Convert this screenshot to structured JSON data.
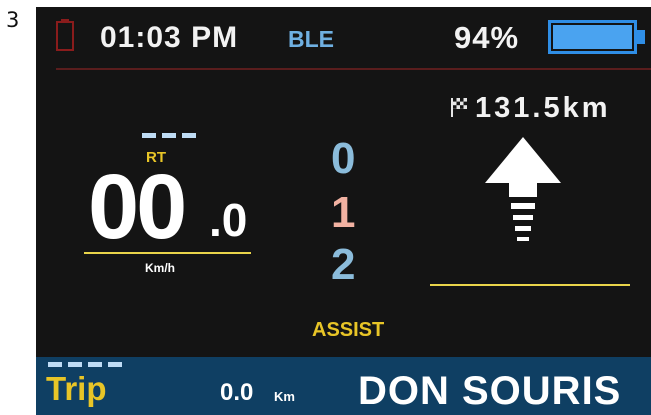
{
  "page_number": "3",
  "status_bar": {
    "time": "01:03 PM",
    "connection": "BLE",
    "battery_percent": "94%",
    "battery_level": 0.94
  },
  "speed": {
    "mode_label": "RT",
    "integer": "00",
    "decimal": ".0",
    "unit": "Km/h"
  },
  "assist": {
    "levels": [
      "0",
      "1",
      "2"
    ],
    "label": "ASSIST"
  },
  "odometer": {
    "value": "131.5km"
  },
  "trip": {
    "label": "Trip",
    "value": "0.0",
    "unit": "Km"
  },
  "brand": "DON SOURIS",
  "colors": {
    "accent_yellow": "#e8c527",
    "accent_blue": "#6fb0e2",
    "assist_active": "#f2b2a2",
    "assist_inactive": "#8bbcdb",
    "bottom_bar": "#0f3f63",
    "screen_bg": "#141414"
  },
  "icons": [
    "battery-icon",
    "flag-icon",
    "arrow-up-icon"
  ]
}
